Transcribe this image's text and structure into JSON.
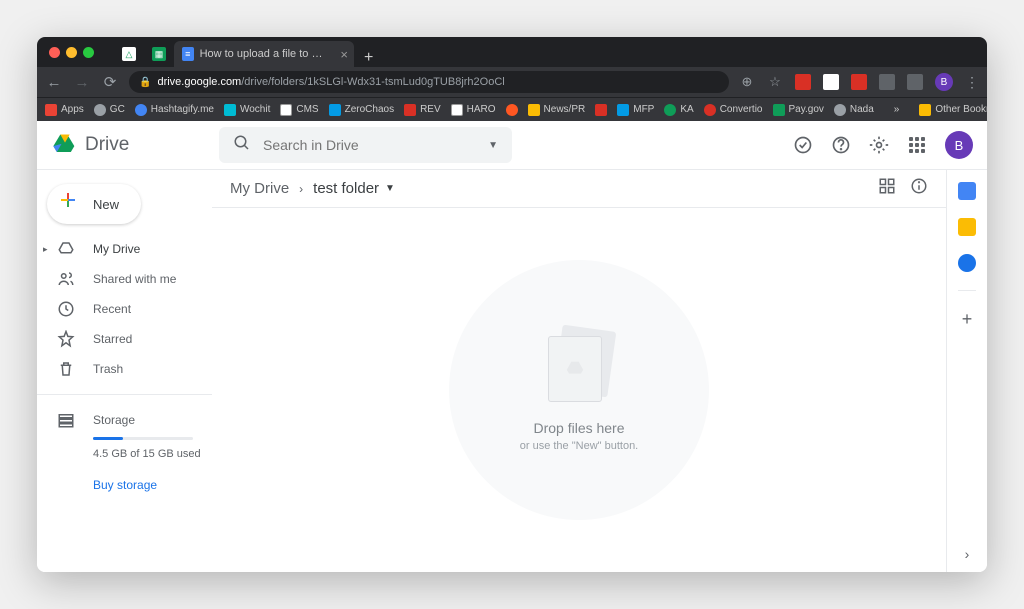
{
  "browser": {
    "tabs": [
      {
        "favicon_bg": "#0f9d58",
        "favicon_glyph": "△"
      },
      {
        "favicon_bg": "#0f9d58",
        "favicon_glyph": "▦"
      },
      {
        "favicon_bg": "#4285f4",
        "favicon_glyph": "≡",
        "title": "How to upload a file to Google D",
        "active": true
      }
    ],
    "url_host": "drive.google.com",
    "url_path": "/drive/folders/1kSLGl-Wdx31-tsmLud0gTUB8jrh2OoCl",
    "profile_initial": "B"
  },
  "bookmarks": {
    "apps": "Apps",
    "items": [
      "GC",
      "Hashtagify.me",
      "Wochit",
      "CMS",
      "ZeroChaos",
      "REV",
      "HARO",
      "",
      "News/PR",
      "",
      "MFP",
      "KA",
      "Convertio",
      "Pay.gov",
      "Nada"
    ],
    "overflow": "»",
    "other": "Other Bookmarks"
  },
  "drive": {
    "logo_text": "Drive",
    "search_placeholder": "Search in Drive",
    "avatar_initial": "B",
    "new_button": "New",
    "nav": {
      "my_drive": "My Drive",
      "shared": "Shared with me",
      "recent": "Recent",
      "starred": "Starred",
      "trash": "Trash",
      "storage": "Storage"
    },
    "storage_text": "4.5 GB of 15 GB used",
    "storage_percent": 30,
    "buy_storage": "Buy storage",
    "breadcrumb_root": "My Drive",
    "breadcrumb_current": "test folder",
    "empty_title": "Drop files here",
    "empty_sub": "or use the \"New\" button."
  },
  "rail": {
    "calendar_color": "#4285f4",
    "keep_color": "#fbbc04",
    "tasks_color": "#1a73e8"
  }
}
